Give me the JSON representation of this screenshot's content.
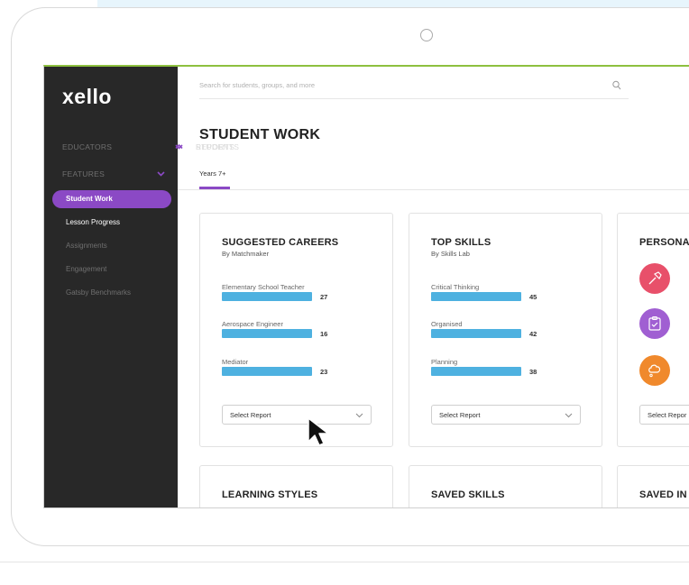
{
  "sidebar": {
    "logo": "xello",
    "nav": [
      {
        "label": "STUDENTS",
        "expandable": true
      },
      {
        "label": "EDUCATORS",
        "expandable": false
      },
      {
        "label": "FEATURES",
        "expandable": true
      },
      {
        "label": "REPORTS",
        "expandable": true,
        "expanded": true
      }
    ],
    "reports_items": [
      {
        "label": "Student Work",
        "active": true
      },
      {
        "label": "Lesson Progress"
      },
      {
        "label": "Assignments"
      },
      {
        "label": "Engagement"
      },
      {
        "label": "Gatsby Benchmarks"
      }
    ]
  },
  "search": {
    "placeholder": "Search for students, groups, and more"
  },
  "page": {
    "title": "STUDENT WORK",
    "tab": "Years 7+"
  },
  "cards": {
    "careers": {
      "title": "SUGGESTED CAREERS",
      "subtitle": "By Matchmaker",
      "rows": [
        {
          "label": "Elementary School Teacher",
          "value": "27"
        },
        {
          "label": "Aerospace Engineer",
          "value": "16"
        },
        {
          "label": "Mediator",
          "value": "23"
        }
      ],
      "select": "Select Report"
    },
    "skills": {
      "title": "TOP SKILLS",
      "subtitle": "By Skills Lab",
      "rows": [
        {
          "label": "Critical Thinking",
          "value": "45"
        },
        {
          "label": "Organised",
          "value": "42"
        },
        {
          "label": "Planning",
          "value": "38"
        }
      ],
      "select": "Select Report"
    },
    "personality": {
      "title": "PERSONA",
      "select": "Select Repor"
    },
    "learning": {
      "title": "LEARNING STYLES"
    },
    "saved_skills": {
      "title": "SAVED SKILLS"
    },
    "saved_interests": {
      "title": "SAVED IN"
    }
  },
  "colors": {
    "accent": "#8b49c5",
    "bar": "#4eb1e0",
    "sidebar": "#282828",
    "icon_red": "#e8506a",
    "icon_purple": "#a05fd2",
    "icon_orange": "#f0892c"
  }
}
